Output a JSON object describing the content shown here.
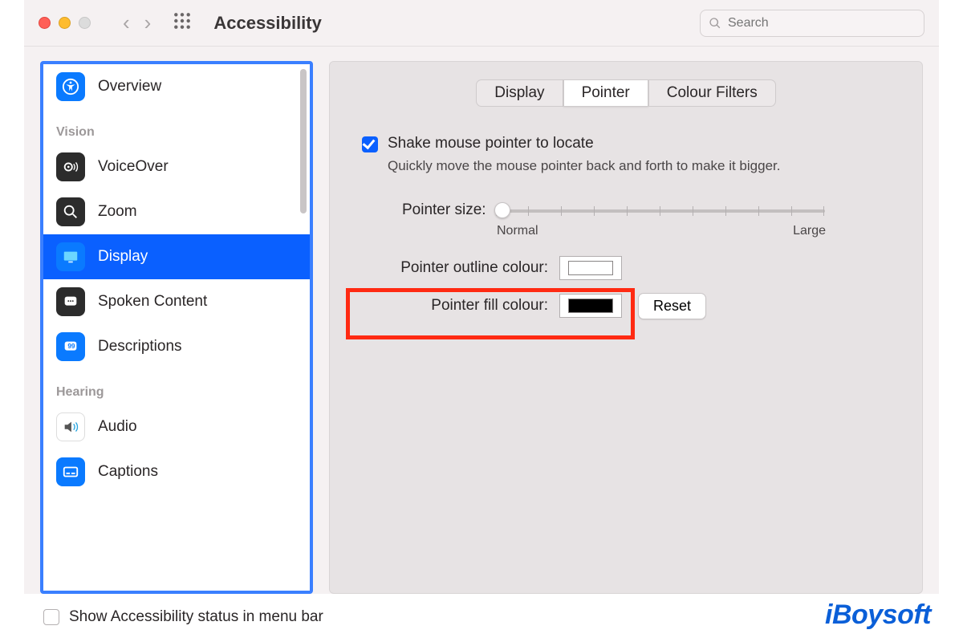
{
  "window": {
    "title": "Accessibility",
    "search_placeholder": "Search"
  },
  "sidebar": {
    "sections": [
      {
        "label": "",
        "items": [
          {
            "key": "overview",
            "label": "Overview",
            "icon": "accessibility-icon",
            "selected": false
          }
        ]
      },
      {
        "label": "Vision",
        "items": [
          {
            "key": "voiceover",
            "label": "VoiceOver",
            "icon": "voiceover-icon",
            "selected": false
          },
          {
            "key": "zoom",
            "label": "Zoom",
            "icon": "zoom-icon",
            "selected": false
          },
          {
            "key": "display",
            "label": "Display",
            "icon": "display-icon",
            "selected": true
          },
          {
            "key": "spoken",
            "label": "Spoken Content",
            "icon": "spoken-content-icon",
            "selected": false
          },
          {
            "key": "descriptions",
            "label": "Descriptions",
            "icon": "descriptions-icon",
            "selected": false
          }
        ]
      },
      {
        "label": "Hearing",
        "items": [
          {
            "key": "audio",
            "label": "Audio",
            "icon": "audio-icon",
            "selected": false
          },
          {
            "key": "captions",
            "label": "Captions",
            "icon": "captions-icon",
            "selected": false
          }
        ]
      }
    ]
  },
  "tabs": {
    "items": [
      {
        "label": "Display",
        "active": false
      },
      {
        "label": "Pointer",
        "active": true
      },
      {
        "label": "Colour Filters",
        "active": false
      }
    ]
  },
  "panel": {
    "shake_label": "Shake mouse pointer to locate",
    "shake_desc": "Quickly move the mouse pointer back and forth to make it bigger.",
    "shake_checked": true,
    "pointer_size_label": "Pointer size:",
    "pointer_size_min": "Normal",
    "pointer_size_max": "Large",
    "outline_label": "Pointer outline colour:",
    "fill_label": "Pointer fill colour:",
    "reset_label": "Reset",
    "outline_color": "#ffffff",
    "fill_color": "#000000"
  },
  "footer": {
    "show_status_label": "Show Accessibility status in menu bar",
    "checked": false
  },
  "watermark": "iBoysoft"
}
